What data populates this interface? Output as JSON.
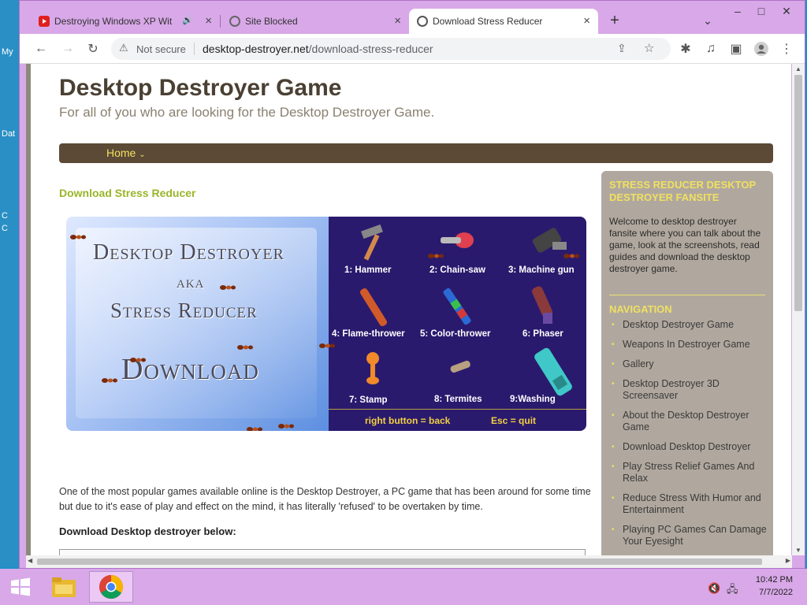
{
  "desktop": {
    "icon_labels": [
      "My",
      "Dat",
      "C",
      "C"
    ]
  },
  "browser": {
    "tabs": [
      {
        "title": "Destroying Windows XP Wit",
        "favicon": "youtube-icon",
        "state": "inactive"
      },
      {
        "title": "Site Blocked",
        "favicon": "globe-icon",
        "state": "inactive"
      },
      {
        "title": "Download Stress Reducer",
        "favicon": "globe-icon",
        "state": "active"
      }
    ],
    "new_tab": "+",
    "window_controls": {
      "dropdown": "⌄",
      "minimize": "–",
      "maximize": "□",
      "close": "✕"
    },
    "security_label": "Not secure",
    "url_domain": "desktop-destroyer.net",
    "url_path": "/download-stress-reducer"
  },
  "page": {
    "site_title": "Desktop Destroyer Game",
    "tagline": "For all of you who are looking for the Desktop Destroyer Game.",
    "nav_home": "Home",
    "heading": "Download Stress Reducer",
    "banner": {
      "line1": "Desktop Destroyer",
      "line2": "aka",
      "line3": "Stress Reducer",
      "line4": "Download",
      "weapons": [
        "1: Hammer",
        "2: Chain-saw",
        "3: Machine gun",
        "4: Flame-thrower",
        "5: Color-thrower",
        "6: Phaser",
        "7: Stamp",
        "8: Termites",
        "9:Washing"
      ],
      "key_back": "right button = back",
      "key_quit": "Esc = quit"
    },
    "body_text": "One of the most popular games available online is the Desktop Destroyer, a PC game that has been around for some time but due to it's ease of play and effect on the mind, it has literally 'refused' to be overtaken by time.",
    "download_heading": "Download Desktop destroyer below:"
  },
  "sidebar": {
    "about_title": "STRESS REDUCER DESKTOP DESTROYER FANSITE",
    "about_text": "Welcome to desktop destroyer fansite where you can talk about the game, look at the screenshots, read guides and download the desktop destroyer game.",
    "nav_title": "NAVIGATION",
    "nav_items": [
      "Desktop Destroyer Game",
      "Weapons In Destroyer Game",
      "Gallery",
      "Desktop Destroyer 3D Screensaver",
      "About the Desktop Destroyer Game",
      "Download Desktop Destroyer",
      "Play Stress Relief Games And Relax",
      "Reduce Stress With Humor and Entertainment",
      "Playing PC Games Can Damage Your Eyesight"
    ]
  },
  "taskbar": {
    "time": "10:42 PM",
    "date": "7/7/2022"
  },
  "colors": {
    "accent_green": "#9ab52a",
    "nav_brown": "#5c4a36",
    "sidebar_bg": "#b0a89e",
    "sidebar_title": "#f0e060",
    "frame": "#d8a8e8"
  }
}
